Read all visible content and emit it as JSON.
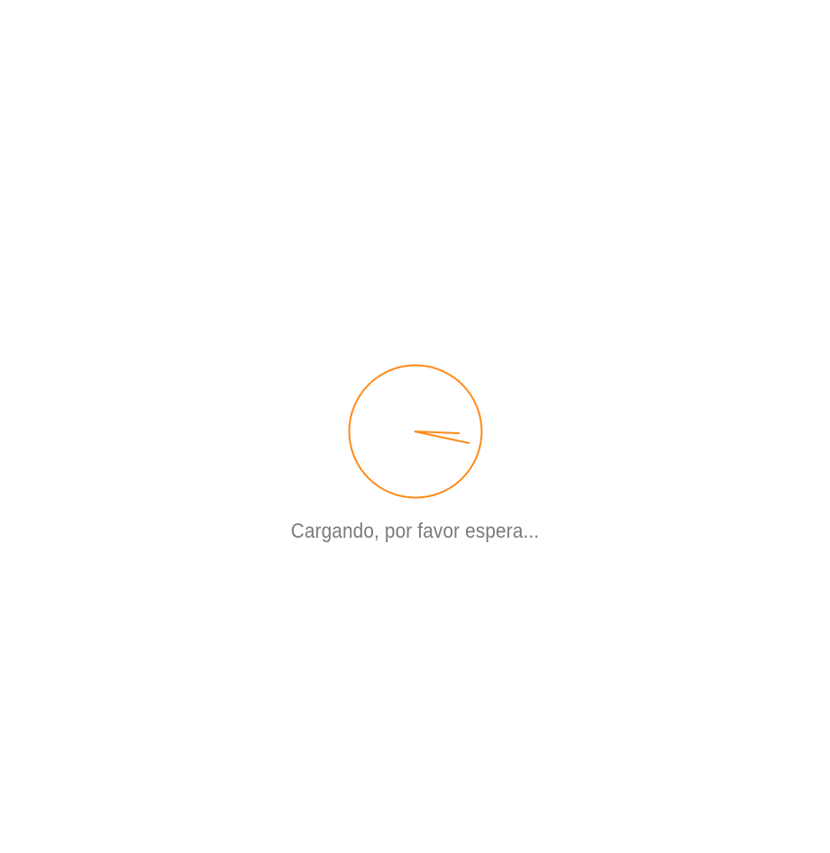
{
  "loading": {
    "message": "Cargando, por favor espera...",
    "spinner_icon": "clock-spinner-icon",
    "accent_color": "#ff8a1a",
    "text_color": "#7a7a7a"
  }
}
